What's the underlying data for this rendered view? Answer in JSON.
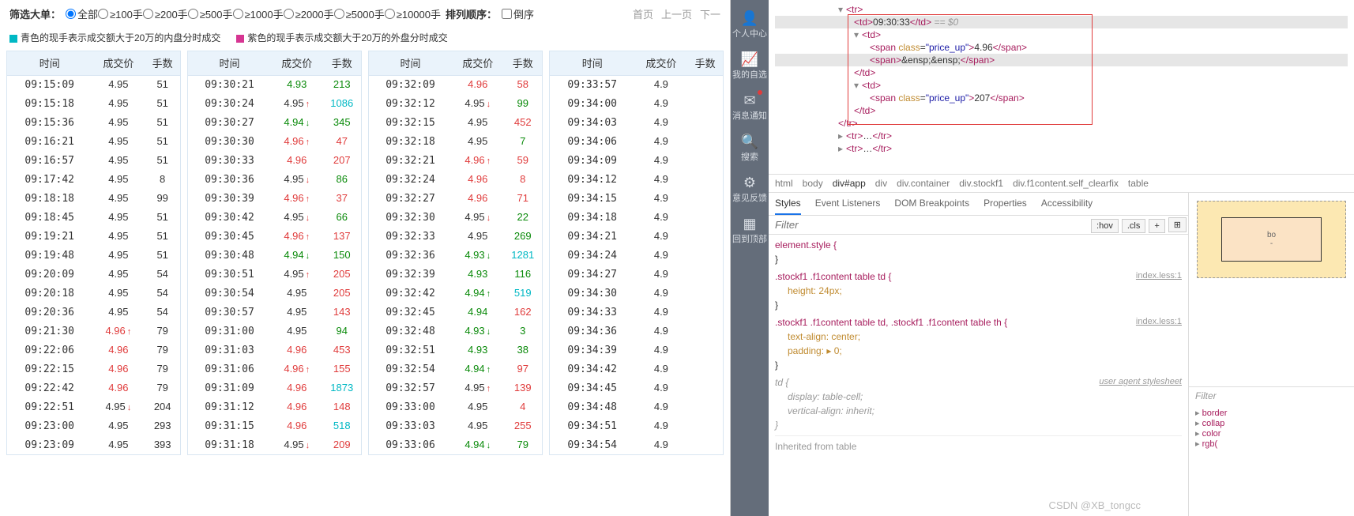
{
  "filters": {
    "label": "筛选大单：",
    "options": [
      "全部",
      "≥100手",
      "≥200手",
      "≥500手",
      "≥1000手",
      "≥2000手",
      "≥5000手",
      "≥10000手"
    ],
    "selected": 0,
    "sort_label": "排列顺序：",
    "sort_checkbox": "倒序",
    "nav": [
      "首页",
      "上一页",
      "下一"
    ]
  },
  "legend": {
    "cyan": "青色的现手表示成交额大于20万的内盘分时成交",
    "magenta": "紫色的现手表示成交额大于20万的外盘分时成交"
  },
  "headers": [
    "时间",
    "成交价",
    "手数"
  ],
  "tables": [
    [
      {
        "t": "09:15:09",
        "p": "4.95",
        "pc": "",
        "a": "",
        "v": "51",
        "vc": ""
      },
      {
        "t": "09:15:18",
        "p": "4.95",
        "pc": "",
        "a": "",
        "v": "51",
        "vc": ""
      },
      {
        "t": "09:15:36",
        "p": "4.95",
        "pc": "",
        "a": "",
        "v": "51",
        "vc": ""
      },
      {
        "t": "09:16:21",
        "p": "4.95",
        "pc": "",
        "a": "",
        "v": "51",
        "vc": ""
      },
      {
        "t": "09:16:57",
        "p": "4.95",
        "pc": "",
        "a": "",
        "v": "51",
        "vc": ""
      },
      {
        "t": "09:17:42",
        "p": "4.95",
        "pc": "",
        "a": "",
        "v": "8",
        "vc": ""
      },
      {
        "t": "09:18:18",
        "p": "4.95",
        "pc": "",
        "a": "",
        "v": "99",
        "vc": ""
      },
      {
        "t": "09:18:45",
        "p": "4.95",
        "pc": "",
        "a": "",
        "v": "51",
        "vc": ""
      },
      {
        "t": "09:19:21",
        "p": "4.95",
        "pc": "",
        "a": "",
        "v": "51",
        "vc": ""
      },
      {
        "t": "09:19:48",
        "p": "4.95",
        "pc": "",
        "a": "",
        "v": "51",
        "vc": ""
      },
      {
        "t": "09:20:09",
        "p": "4.95",
        "pc": "",
        "a": "",
        "v": "54",
        "vc": ""
      },
      {
        "t": "09:20:18",
        "p": "4.95",
        "pc": "",
        "a": "",
        "v": "54",
        "vc": ""
      },
      {
        "t": "09:20:36",
        "p": "4.95",
        "pc": "",
        "a": "",
        "v": "54",
        "vc": ""
      },
      {
        "t": "09:21:30",
        "p": "4.96",
        "pc": "up",
        "a": "↑",
        "v": "79",
        "vc": ""
      },
      {
        "t": "09:22:06",
        "p": "4.96",
        "pc": "up",
        "a": "",
        "v": "79",
        "vc": ""
      },
      {
        "t": "09:22:15",
        "p": "4.96",
        "pc": "up",
        "a": "",
        "v": "79",
        "vc": ""
      },
      {
        "t": "09:22:42",
        "p": "4.96",
        "pc": "up",
        "a": "",
        "v": "79",
        "vc": ""
      },
      {
        "t": "09:22:51",
        "p": "4.95",
        "pc": "",
        "a": "↓",
        "v": "204",
        "vc": ""
      },
      {
        "t": "09:23:00",
        "p": "4.95",
        "pc": "",
        "a": "",
        "v": "293",
        "vc": ""
      },
      {
        "t": "09:23:09",
        "p": "4.95",
        "pc": "",
        "a": "",
        "v": "393",
        "vc": ""
      }
    ],
    [
      {
        "t": "09:30:21",
        "p": "4.93",
        "pc": "down",
        "a": "",
        "v": "213",
        "vc": "down"
      },
      {
        "t": "09:30:24",
        "p": "4.95",
        "pc": "",
        "a": "↑",
        "v": "1086",
        "vc": "mag"
      },
      {
        "t": "09:30:27",
        "p": "4.94",
        "pc": "down",
        "a": "↓",
        "v": "345",
        "vc": "down"
      },
      {
        "t": "09:30:30",
        "p": "4.96",
        "pc": "up",
        "a": "↑",
        "v": "47",
        "vc": "up"
      },
      {
        "t": "09:30:33",
        "p": "4.96",
        "pc": "up",
        "a": "",
        "v": "207",
        "vc": "up"
      },
      {
        "t": "09:30:36",
        "p": "4.95",
        "pc": "",
        "a": "↓",
        "v": "86",
        "vc": "down"
      },
      {
        "t": "09:30:39",
        "p": "4.96",
        "pc": "up",
        "a": "↑",
        "v": "37",
        "vc": "up"
      },
      {
        "t": "09:30:42",
        "p": "4.95",
        "pc": "",
        "a": "↓",
        "v": "66",
        "vc": "down"
      },
      {
        "t": "09:30:45",
        "p": "4.96",
        "pc": "up",
        "a": "↑",
        "v": "137",
        "vc": "up"
      },
      {
        "t": "09:30:48",
        "p": "4.94",
        "pc": "down",
        "a": "↓",
        "v": "150",
        "vc": "down"
      },
      {
        "t": "09:30:51",
        "p": "4.95",
        "pc": "",
        "a": "↑",
        "v": "205",
        "vc": "up"
      },
      {
        "t": "09:30:54",
        "p": "4.95",
        "pc": "",
        "a": "",
        "v": "205",
        "vc": "up"
      },
      {
        "t": "09:30:57",
        "p": "4.95",
        "pc": "",
        "a": "",
        "v": "143",
        "vc": "up"
      },
      {
        "t": "09:31:00",
        "p": "4.95",
        "pc": "",
        "a": "",
        "v": "94",
        "vc": "down"
      },
      {
        "t": "09:31:03",
        "p": "4.96",
        "pc": "up",
        "a": "",
        "v": "453",
        "vc": "up"
      },
      {
        "t": "09:31:06",
        "p": "4.96",
        "pc": "up",
        "a": "↑",
        "v": "155",
        "vc": "up"
      },
      {
        "t": "09:31:09",
        "p": "4.96",
        "pc": "up",
        "a": "",
        "v": "1873",
        "vc": "mag"
      },
      {
        "t": "09:31:12",
        "p": "4.96",
        "pc": "up",
        "a": "",
        "v": "148",
        "vc": "up"
      },
      {
        "t": "09:31:15",
        "p": "4.96",
        "pc": "up",
        "a": "",
        "v": "518",
        "vc": "cyan"
      },
      {
        "t": "09:31:18",
        "p": "4.95",
        "pc": "",
        "a": "↓",
        "v": "209",
        "vc": "up"
      }
    ],
    [
      {
        "t": "09:32:09",
        "p": "4.96",
        "pc": "up",
        "a": "",
        "v": "58",
        "vc": "up"
      },
      {
        "t": "09:32:12",
        "p": "4.95",
        "pc": "",
        "a": "↓",
        "v": "99",
        "vc": "down"
      },
      {
        "t": "09:32:15",
        "p": "4.95",
        "pc": "",
        "a": "",
        "v": "452",
        "vc": "up"
      },
      {
        "t": "09:32:18",
        "p": "4.95",
        "pc": "",
        "a": "",
        "v": "7",
        "vc": "down"
      },
      {
        "t": "09:32:21",
        "p": "4.96",
        "pc": "up",
        "a": "↑",
        "v": "59",
        "vc": "up"
      },
      {
        "t": "09:32:24",
        "p": "4.96",
        "pc": "up",
        "a": "",
        "v": "8",
        "vc": "up"
      },
      {
        "t": "09:32:27",
        "p": "4.96",
        "pc": "up",
        "a": "",
        "v": "71",
        "vc": "up"
      },
      {
        "t": "09:32:30",
        "p": "4.95",
        "pc": "",
        "a": "↓",
        "v": "22",
        "vc": "down"
      },
      {
        "t": "09:32:33",
        "p": "4.95",
        "pc": "",
        "a": "",
        "v": "269",
        "vc": "down"
      },
      {
        "t": "09:32:36",
        "p": "4.93",
        "pc": "down",
        "a": "↓",
        "v": "1281",
        "vc": "cyan"
      },
      {
        "t": "09:32:39",
        "p": "4.93",
        "pc": "down",
        "a": "",
        "v": "116",
        "vc": "down"
      },
      {
        "t": "09:32:42",
        "p": "4.94",
        "pc": "down",
        "a": "↑",
        "v": "519",
        "vc": "mag"
      },
      {
        "t": "09:32:45",
        "p": "4.94",
        "pc": "down",
        "a": "",
        "v": "162",
        "vc": "up"
      },
      {
        "t": "09:32:48",
        "p": "4.93",
        "pc": "down",
        "a": "↓",
        "v": "3",
        "vc": "down"
      },
      {
        "t": "09:32:51",
        "p": "4.93",
        "pc": "down",
        "a": "",
        "v": "38",
        "vc": "down"
      },
      {
        "t": "09:32:54",
        "p": "4.94",
        "pc": "down",
        "a": "↑",
        "v": "97",
        "vc": "up"
      },
      {
        "t": "09:32:57",
        "p": "4.95",
        "pc": "",
        "a": "↑",
        "v": "139",
        "vc": "up"
      },
      {
        "t": "09:33:00",
        "p": "4.95",
        "pc": "",
        "a": "",
        "v": "4",
        "vc": "up"
      },
      {
        "t": "09:33:03",
        "p": "4.95",
        "pc": "",
        "a": "",
        "v": "255",
        "vc": "up"
      },
      {
        "t": "09:33:06",
        "p": "4.94",
        "pc": "down",
        "a": "↓",
        "v": "79",
        "vc": "down"
      }
    ],
    [
      {
        "t": "09:33:57",
        "p": "4.9",
        "pc": "",
        "a": "",
        "v": "",
        "vc": ""
      },
      {
        "t": "09:34:00",
        "p": "4.9",
        "pc": "",
        "a": "",
        "v": "",
        "vc": ""
      },
      {
        "t": "09:34:03",
        "p": "4.9",
        "pc": "",
        "a": "",
        "v": "",
        "vc": ""
      },
      {
        "t": "09:34:06",
        "p": "4.9",
        "pc": "",
        "a": "",
        "v": "",
        "vc": ""
      },
      {
        "t": "09:34:09",
        "p": "4.9",
        "pc": "",
        "a": "",
        "v": "",
        "vc": ""
      },
      {
        "t": "09:34:12",
        "p": "4.9",
        "pc": "",
        "a": "",
        "v": "",
        "vc": ""
      },
      {
        "t": "09:34:15",
        "p": "4.9",
        "pc": "",
        "a": "",
        "v": "",
        "vc": ""
      },
      {
        "t": "09:34:18",
        "p": "4.9",
        "pc": "",
        "a": "",
        "v": "",
        "vc": ""
      },
      {
        "t": "09:34:21",
        "p": "4.9",
        "pc": "",
        "a": "",
        "v": "",
        "vc": ""
      },
      {
        "t": "09:34:24",
        "p": "4.9",
        "pc": "",
        "a": "",
        "v": "",
        "vc": ""
      },
      {
        "t": "09:34:27",
        "p": "4.9",
        "pc": "",
        "a": "",
        "v": "",
        "vc": ""
      },
      {
        "t": "09:34:30",
        "p": "4.9",
        "pc": "",
        "a": "",
        "v": "",
        "vc": ""
      },
      {
        "t": "09:34:33",
        "p": "4.9",
        "pc": "",
        "a": "",
        "v": "",
        "vc": ""
      },
      {
        "t": "09:34:36",
        "p": "4.9",
        "pc": "",
        "a": "",
        "v": "",
        "vc": ""
      },
      {
        "t": "09:34:39",
        "p": "4.9",
        "pc": "",
        "a": "",
        "v": "",
        "vc": ""
      },
      {
        "t": "09:34:42",
        "p": "4.9",
        "pc": "",
        "a": "",
        "v": "",
        "vc": ""
      },
      {
        "t": "09:34:45",
        "p": "4.9",
        "pc": "",
        "a": "",
        "v": "",
        "vc": ""
      },
      {
        "t": "09:34:48",
        "p": "4.9",
        "pc": "",
        "a": "",
        "v": "",
        "vc": ""
      },
      {
        "t": "09:34:51",
        "p": "4.9",
        "pc": "",
        "a": "",
        "v": "",
        "vc": ""
      },
      {
        "t": "09:34:54",
        "p": "4.9",
        "pc": "",
        "a": "",
        "v": "",
        "vc": ""
      }
    ]
  ],
  "sidebar": [
    {
      "icon": "👤",
      "label": "个人中心"
    },
    {
      "icon": "📈",
      "label": "我的自选"
    },
    {
      "icon": "✉",
      "label": "消息通知",
      "dot": true
    },
    {
      "icon": "🔍",
      "label": "搜索"
    },
    {
      "icon": "⚙",
      "label": "意见反馈"
    },
    {
      "icon": "▦",
      "label": "回到顶部"
    }
  ],
  "devtools": {
    "dom": {
      "line_tr_open": "<tr>",
      "selected_td": "<td>09:30:33</td>",
      "eq0": " == $0",
      "td2_open": "<td>",
      "span1_open": "<span class=\"price_up\">",
      "span1_text": "4.96",
      "span1_close": "</span>",
      "span2": "<span>&ensp;&ensp;</span>",
      "td_close": "</td>",
      "td3_open": "<td>",
      "span3_open": "<span class=\"price_up\">",
      "span3_text": "207",
      "span3_close": "</span>",
      "tr_close": "</tr>",
      "tr_ellipsis": "<tr>…</tr>"
    },
    "crumbs": [
      "html",
      "body",
      "div#app",
      "div",
      "div.container",
      "div.stockf1",
      "div.f1content.self_clearfix",
      "table"
    ],
    "tabs": [
      "Styles",
      "Event Listeners",
      "DOM Breakpoints",
      "Properties",
      "Accessibility"
    ],
    "filter_placeholder": "Filter",
    "filter_btns": [
      ":hov",
      ".cls",
      "+"
    ],
    "styles": {
      "elstyle": "element.style {",
      "close": "}",
      "rule1_sel": ".stockf1 .f1content table td {",
      "rule1_link": "index.less:1",
      "rule1_prop": "height: 24px;",
      "rule2_sel": ".stockf1 .f1content table td, .stockf1 .f1content table th {",
      "rule2_link": "index.less:1",
      "rule2_p1": "text-align: center;",
      "rule2_p2": "padding: ▸ 0;",
      "ua_sel": "td {",
      "ua_label": "user agent stylesheet",
      "ua_p1": "display: table-cell;",
      "ua_p2": "vertical-align: inherit;",
      "inherited": "Inherited from table"
    },
    "rpanel": {
      "box_label": "bo",
      "filter": "Filter",
      "props": [
        "border",
        "collap",
        "color",
        "rgb("
      ]
    }
  },
  "watermark": "CSDN @XB_tongcc"
}
